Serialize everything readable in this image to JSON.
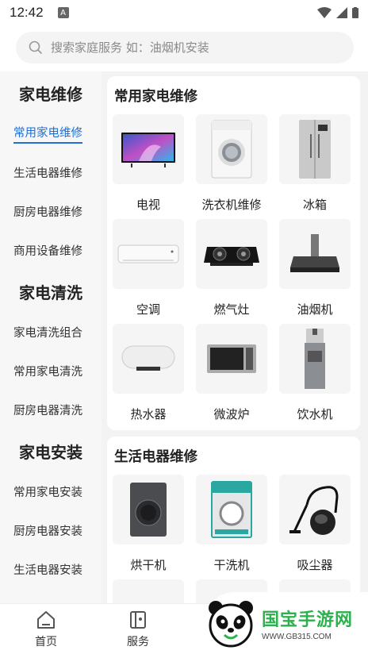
{
  "status": {
    "time": "12:42",
    "badge": "A"
  },
  "search": {
    "placeholder": "搜索家庭服务 如：油烟机安装"
  },
  "sidebar": {
    "groups": [
      {
        "title": "家电维修",
        "items": [
          "常用家电维修",
          "生活电器维修",
          "厨房电器维修",
          "商用设备维修"
        ]
      },
      {
        "title": "家电清洗",
        "items": [
          "家电清洗组合",
          "常用家电清洗",
          "厨房电器清洗"
        ]
      },
      {
        "title": "家电安装",
        "items": [
          "常用家电安装",
          "厨房电器安装",
          "生活电器安装"
        ]
      }
    ],
    "active": "常用家电维修"
  },
  "sections": [
    {
      "title": "常用家电维修",
      "items": [
        {
          "label": "电视",
          "icon": "tv-icon"
        },
        {
          "label": "洗衣机维修",
          "icon": "washing-machine-icon"
        },
        {
          "label": "冰箱",
          "icon": "fridge-icon"
        },
        {
          "label": "空调",
          "icon": "air-conditioner-icon"
        },
        {
          "label": "燃气灶",
          "icon": "gas-stove-icon"
        },
        {
          "label": "油烟机",
          "icon": "range-hood-icon"
        },
        {
          "label": "热水器",
          "icon": "water-heater-icon"
        },
        {
          "label": "微波炉",
          "icon": "microwave-icon"
        },
        {
          "label": "饮水机",
          "icon": "water-dispenser-icon"
        }
      ]
    },
    {
      "title": "生活电器维修",
      "items": [
        {
          "label": "烘干机",
          "icon": "dryer-icon"
        },
        {
          "label": "干洗机",
          "icon": "dry-cleaner-icon"
        },
        {
          "label": "吸尘器",
          "icon": "vacuum-icon"
        }
      ]
    }
  ],
  "tabbar": {
    "tabs": [
      {
        "label": "首页",
        "icon": "home-icon"
      },
      {
        "label": "服务",
        "icon": "service-icon"
      }
    ]
  },
  "watermark": {
    "brand": "国宝手游网",
    "url": "WWW.GB315.COM"
  }
}
